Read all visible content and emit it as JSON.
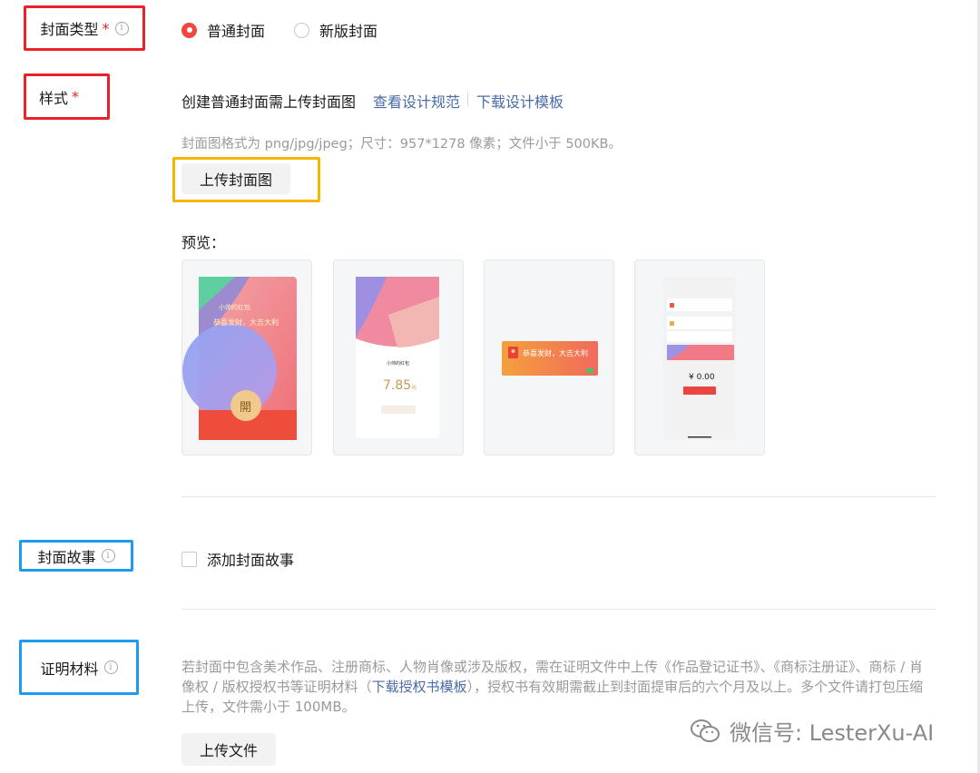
{
  "cover_type": {
    "label": "封面类型",
    "required_mark": "*",
    "options": [
      {
        "label": "普通封面",
        "selected": true
      },
      {
        "label": "新版封面",
        "selected": false
      }
    ]
  },
  "style": {
    "label": "样式",
    "required_mark": "*",
    "instruction": "创建普通封面需上传封面图",
    "link_spec": "查看设计规范",
    "link_template": "下载设计模板",
    "format_hint": "封面图格式为 png/jpg/jpeg；尺寸：957*1278 像素；文件小于 500KB。",
    "upload_button": "上传封面图",
    "preview_label": "预览：",
    "preview1": {
      "sender": "小帅的红包",
      "greeting": "恭喜发财，大吉大利",
      "open_char": "開"
    },
    "preview2": {
      "sender": "小帅的红包",
      "amount": "7.85",
      "unit": "元"
    },
    "preview3": {
      "greeting": "恭喜发财，大吉大利"
    },
    "preview4": {
      "amount": "¥ 0.00"
    }
  },
  "cover_story": {
    "label": "封面故事",
    "checkbox_label": "添加封面故事"
  },
  "proof": {
    "label": "证明材料",
    "text_before": "若封面中包含美术作品、注册商标、人物肖像或涉及版权，需在证明文件中上传《作品登记证书》、《商标注册证》、商标 / 肖像权 / 版权授权书等证明材料（",
    "link": "下载授权书模板",
    "text_after": "），授权书有效期需截止到封面提审后的六个月及以上。多个文件请打包压缩上传，文件需小于 100MB。",
    "upload_button": "上传文件"
  },
  "watermark": {
    "text": "微信号: LesterXu-AI"
  },
  "colors": {
    "accent_red": "#f0463b",
    "annotation_red": "#e8212a",
    "annotation_yellow": "#f7b500",
    "annotation_blue": "#1e9bef",
    "link": "#4a6ba8"
  }
}
